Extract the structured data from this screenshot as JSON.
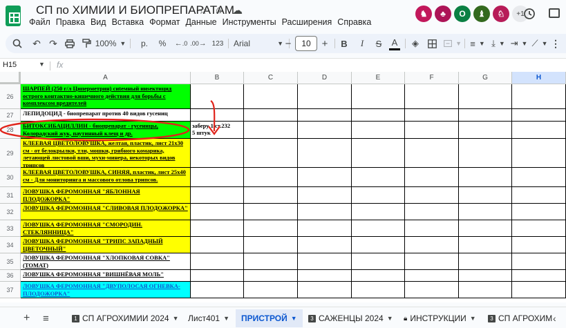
{
  "document": {
    "title": "СП по ХИМИИ И БИОПРЕПАРАТАМ",
    "title_icons": [
      "star-icon",
      "move-to-folder-icon",
      "cloud-saved-icon"
    ]
  },
  "menu": [
    "Файл",
    "Правка",
    "Вид",
    "Вставка",
    "Формат",
    "Данные",
    "Инструменты",
    "Расширения",
    "Справка"
  ],
  "collaborators": {
    "initial": "O",
    "extra_count": "+1",
    "avatar_colors": [
      "#c2185b",
      "#ad1457",
      "#0b8043",
      "#33691e",
      "#b71c58"
    ]
  },
  "toolbar": {
    "zoom": "100%",
    "currency": "р.",
    "percent": "%",
    "decrease_decimals": ".0",
    "increase_decimals": ".00",
    "number_format": "123",
    "font": "Arial",
    "font_size": "10",
    "bold": "B",
    "italic": "I",
    "text_color": "A"
  },
  "formula_bar": {
    "cell_ref": "H15",
    "fx": "fx"
  },
  "columns": [
    "A",
    "B",
    "C",
    "D",
    "E",
    "F",
    "G",
    "H"
  ],
  "selected_column": "H",
  "rows": [
    {
      "num": "26",
      "a": "ШАРПЕЙ (250 г/л Циперметрин) сиtемный ииsектицид острого контактно-кишечного действия для борьбы с комплексом вредителей",
      "bg": "#00ff00",
      "color": "black"
    },
    {
      "num": "27",
      "a": "ЛЕПИДОЦИД - биопрепарат против 40 видов гусениц",
      "bg": "#ffffff",
      "color": "black",
      "plain": true
    },
    {
      "num": "28",
      "a": "БИТОКСИБАЦИЛЛИН - биопрепарат - гусеницы, Колорадский жук, паутинный клещ и др.",
      "bg": "#00ff00",
      "color": "black",
      "b": "заберу 1 ст.232\n5 штук"
    },
    {
      "num": "29",
      "a": "КЛЕЕВАЯ ЦВЕТОЛОВУШКА, желтая, пластик, лист 21х30 см - от белокрылки, тли, мошки, грибного комарика, летающей листовой вши, мухи-минера, некоторых видов трипсов",
      "bg": "#ffff00",
      "color": "black"
    },
    {
      "num": "30",
      "a": "КЛЕЕВАЯ ЦВЕТОЛОВУШКА, СИНЯЯ, пластик, лист 25х40 см - Для мониторинга и массового отлова трипсов.",
      "bg": "#ffff00",
      "color": "black"
    },
    {
      "num": "31",
      "a": "ЛОВУШКА ФЕРОМОННАЯ \"ЯБЛОННАЯ ПЛОДОЖОРКА\"",
      "bg": "#ffff00",
      "color": "black"
    },
    {
      "num": "32",
      "a": "ЛОВУШКА ФЕРОМОННАЯ \"СЛИВОВАЯ ПЛОДОЖОРКА\"",
      "bg": "#ffff00",
      "color": "black"
    },
    {
      "num": "33",
      "a": "ЛОВУШКА ФЕРОМОННАЯ \"СМОРОДИН. СТЕКЛЯННИЦА\"",
      "bg": "#ffff00",
      "color": "black"
    },
    {
      "num": "34",
      "a": "ЛОВУШКА ФЕРОМОННАЯ \"ТРИПС ЗАПАДНЫЙ ЦВЕТОЧНЫЙ\"",
      "bg": "#ffff00",
      "color": "black"
    },
    {
      "num": "35",
      "a": "ЛОВУШКА ФЕРОМОННАЯ \"ХЛОПКОВАЯ СОВКА\"(ТОМАТ)",
      "bg": "#ffffff",
      "color": "black"
    },
    {
      "num": "36",
      "a": "ЛОВУШКА ФЕРОМОННАЯ \"ВИШНЁВАЯ МОЛЬ\"",
      "bg": "#ffffff",
      "color": "black"
    },
    {
      "num": "37",
      "a": "ЛОВУШКА ФЕРОМОННАЯ \"ДВУПОЛОСАЯ ОГНЕВКА-ПЛОДОЖОРКА\"",
      "bg": "#00ffff",
      "color": "blue"
    }
  ],
  "annotation": {
    "stroke_color": "#e0241b"
  },
  "sheet_tabs": [
    {
      "num": "1",
      "label": "СП АГРОХИМИИ 2024",
      "active": false
    },
    {
      "num": "",
      "label": "Лист401",
      "active": false
    },
    {
      "num": "",
      "label": "ПРИСТРОЙ",
      "active": true
    },
    {
      "num": "3",
      "label": "САЖЕНЦЫ 2024",
      "active": false
    },
    {
      "num": "",
      "label": "ИНСТРУКЦИИ",
      "active": false,
      "lock": true
    },
    {
      "num": "3",
      "label": "СП АГРОХИМ",
      "active": false
    }
  ]
}
